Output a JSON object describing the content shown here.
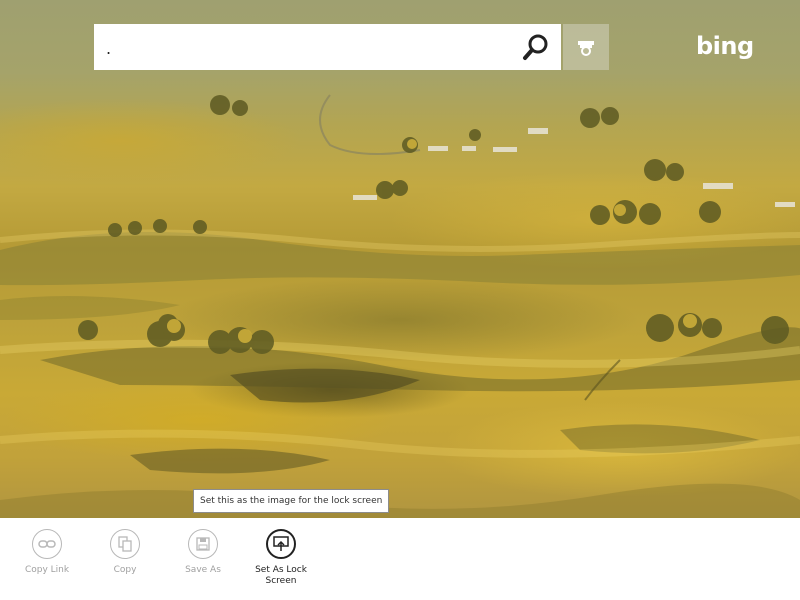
{
  "search": {
    "value": ".",
    "placeholder": ""
  },
  "icons": {
    "search": "search-icon",
    "camera": "camera-icon",
    "copy_link": "link-icon",
    "copy": "copy-icon",
    "save_as": "floppy-disk-icon",
    "lock_screen": "lock-screen-icon"
  },
  "logo": {
    "text": "bing"
  },
  "tooltip": {
    "text": "Set this as the image for the lock screen"
  },
  "appbar": {
    "commands": [
      {
        "label": "Copy Link"
      },
      {
        "label": "Copy"
      },
      {
        "label": "Save As"
      },
      {
        "label": "Set As Lock Screen"
      }
    ]
  },
  "colors": {
    "appbar_bg": "#ffffff",
    "disabled_text": "#a0a0a0",
    "active_text": "#222222",
    "landscape_gold": "#c3a942"
  }
}
